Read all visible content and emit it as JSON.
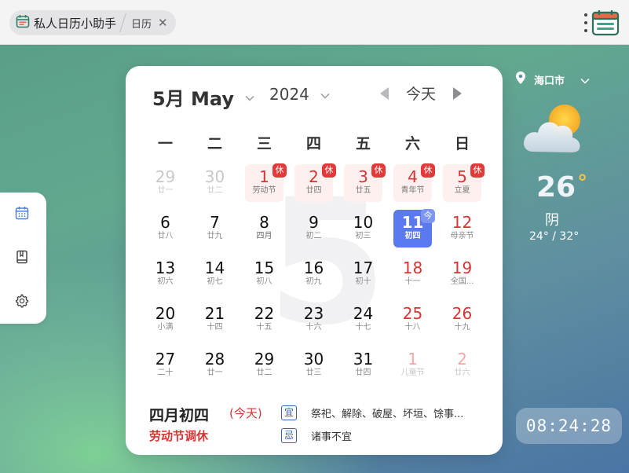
{
  "window": {
    "app_tab_label": "私人日历小助手",
    "sub_tab_label": "日历",
    "close_symbol": "✕"
  },
  "sidebar": {
    "items": [
      {
        "icon": "calendar-icon"
      },
      {
        "icon": "book-icon"
      },
      {
        "icon": "gear-icon"
      }
    ]
  },
  "calendar": {
    "month_label": "5月 May",
    "year_label": "2024",
    "today_button": "今天",
    "watermark": "5",
    "weekdays": [
      "一",
      "二",
      "三",
      "四",
      "五",
      "六",
      "日"
    ],
    "weeks": [
      [
        {
          "num": "29",
          "sub": "廿一",
          "style": "dim"
        },
        {
          "num": "30",
          "sub": "廿二",
          "style": "dim"
        },
        {
          "num": "1",
          "sub": "劳动节",
          "style": "holiday",
          "badge": "休"
        },
        {
          "num": "2",
          "sub": "廿四",
          "style": "holiday",
          "badge": "休"
        },
        {
          "num": "3",
          "sub": "廿五",
          "style": "holiday",
          "badge": "休"
        },
        {
          "num": "4",
          "sub": "青年节",
          "style": "holiday",
          "badge": "休"
        },
        {
          "num": "5",
          "sub": "立夏",
          "style": "holiday",
          "badge": "休"
        }
      ],
      [
        {
          "num": "6",
          "sub": "廿八",
          "style": ""
        },
        {
          "num": "7",
          "sub": "廿九",
          "style": ""
        },
        {
          "num": "8",
          "sub": "四月",
          "style": "festival"
        },
        {
          "num": "9",
          "sub": "初二",
          "style": ""
        },
        {
          "num": "10",
          "sub": "初三",
          "style": ""
        },
        {
          "num": "11",
          "sub": "初四",
          "style": "today",
          "badge": "今"
        },
        {
          "num": "12",
          "sub": "母亲节",
          "style": "red"
        }
      ],
      [
        {
          "num": "13",
          "sub": "初六",
          "style": ""
        },
        {
          "num": "14",
          "sub": "初七",
          "style": ""
        },
        {
          "num": "15",
          "sub": "初八",
          "style": ""
        },
        {
          "num": "16",
          "sub": "初九",
          "style": ""
        },
        {
          "num": "17",
          "sub": "初十",
          "style": ""
        },
        {
          "num": "18",
          "sub": "十一",
          "style": "red"
        },
        {
          "num": "19",
          "sub": "全国...",
          "style": "red"
        }
      ],
      [
        {
          "num": "20",
          "sub": "小满",
          "style": ""
        },
        {
          "num": "21",
          "sub": "十四",
          "style": ""
        },
        {
          "num": "22",
          "sub": "十五",
          "style": ""
        },
        {
          "num": "23",
          "sub": "十六",
          "style": ""
        },
        {
          "num": "24",
          "sub": "十七",
          "style": ""
        },
        {
          "num": "25",
          "sub": "十八",
          "style": "red"
        },
        {
          "num": "26",
          "sub": "十九",
          "style": "red"
        }
      ],
      [
        {
          "num": "27",
          "sub": "二十",
          "style": ""
        },
        {
          "num": "28",
          "sub": "廿一",
          "style": ""
        },
        {
          "num": "29",
          "sub": "廿二",
          "style": ""
        },
        {
          "num": "30",
          "sub": "廿三",
          "style": ""
        },
        {
          "num": "31",
          "sub": "廿四",
          "style": ""
        },
        {
          "num": "1",
          "sub": "儿童节",
          "style": "dimred"
        },
        {
          "num": "2",
          "sub": "廿六",
          "style": "dimred"
        }
      ]
    ],
    "footer": {
      "lunar_date": "四月初四",
      "today_label": "(今天)",
      "holiday_note": "劳动节调休",
      "yi_label": "宜",
      "yi_text": "祭祀、解除、破屋、坏垣、馀事...",
      "ji_label": "忌",
      "ji_text": "诸事不宜"
    }
  },
  "weather": {
    "location": "海口市",
    "temperature": "26",
    "degree_symbol": "°",
    "condition": "阴",
    "range": "24° / 32°",
    "icon": "partly-cloudy-icon"
  },
  "clock": {
    "time": "08:24:28"
  },
  "colors": {
    "accent": "#5b79ee",
    "holiday_red": "#d93434",
    "holiday_bg": "#fdf0ef",
    "tag_blue": "#3a5fb8"
  }
}
